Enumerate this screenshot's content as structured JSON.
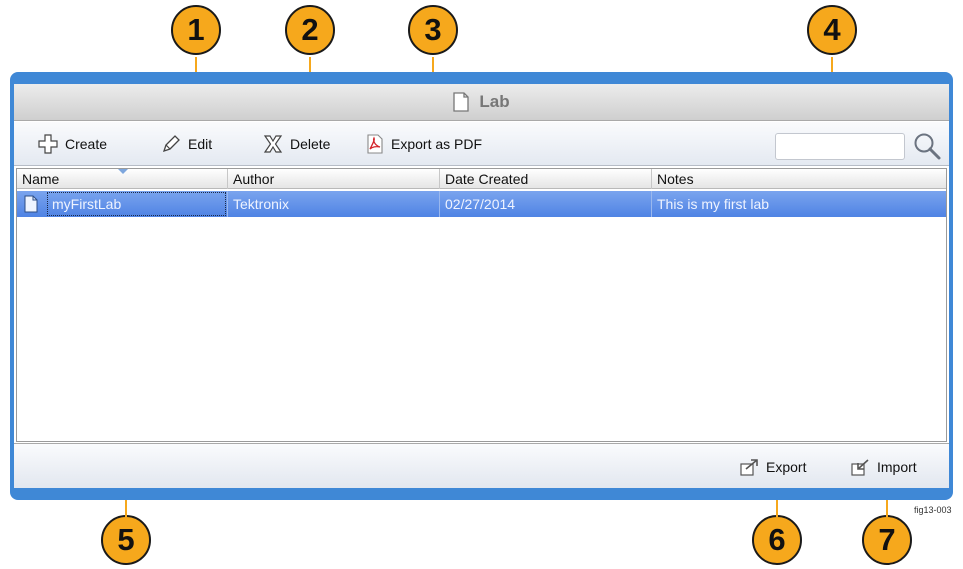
{
  "callouts": [
    "1",
    "2",
    "3",
    "4",
    "5",
    "6",
    "7"
  ],
  "window": {
    "title": "Lab"
  },
  "toolbar": {
    "create_label": "Create",
    "edit_label": "Edit",
    "delete_label": "Delete",
    "export_pdf_label": "Export as PDF",
    "search_value": ""
  },
  "table": {
    "columns": [
      "Name",
      "Author",
      "Date Created",
      "Notes"
    ],
    "rows": [
      {
        "name": "myFirstLab",
        "author": "Tektronix",
        "date": "02/27/2014",
        "notes": "This is my first lab"
      }
    ]
  },
  "footer": {
    "export_label": "Export",
    "import_label": "Import"
  },
  "figure_label": "fig13-003",
  "colors": {
    "callout": "#f6a81c",
    "frame": "#3f88d6",
    "selection": "#5e8fe8"
  }
}
